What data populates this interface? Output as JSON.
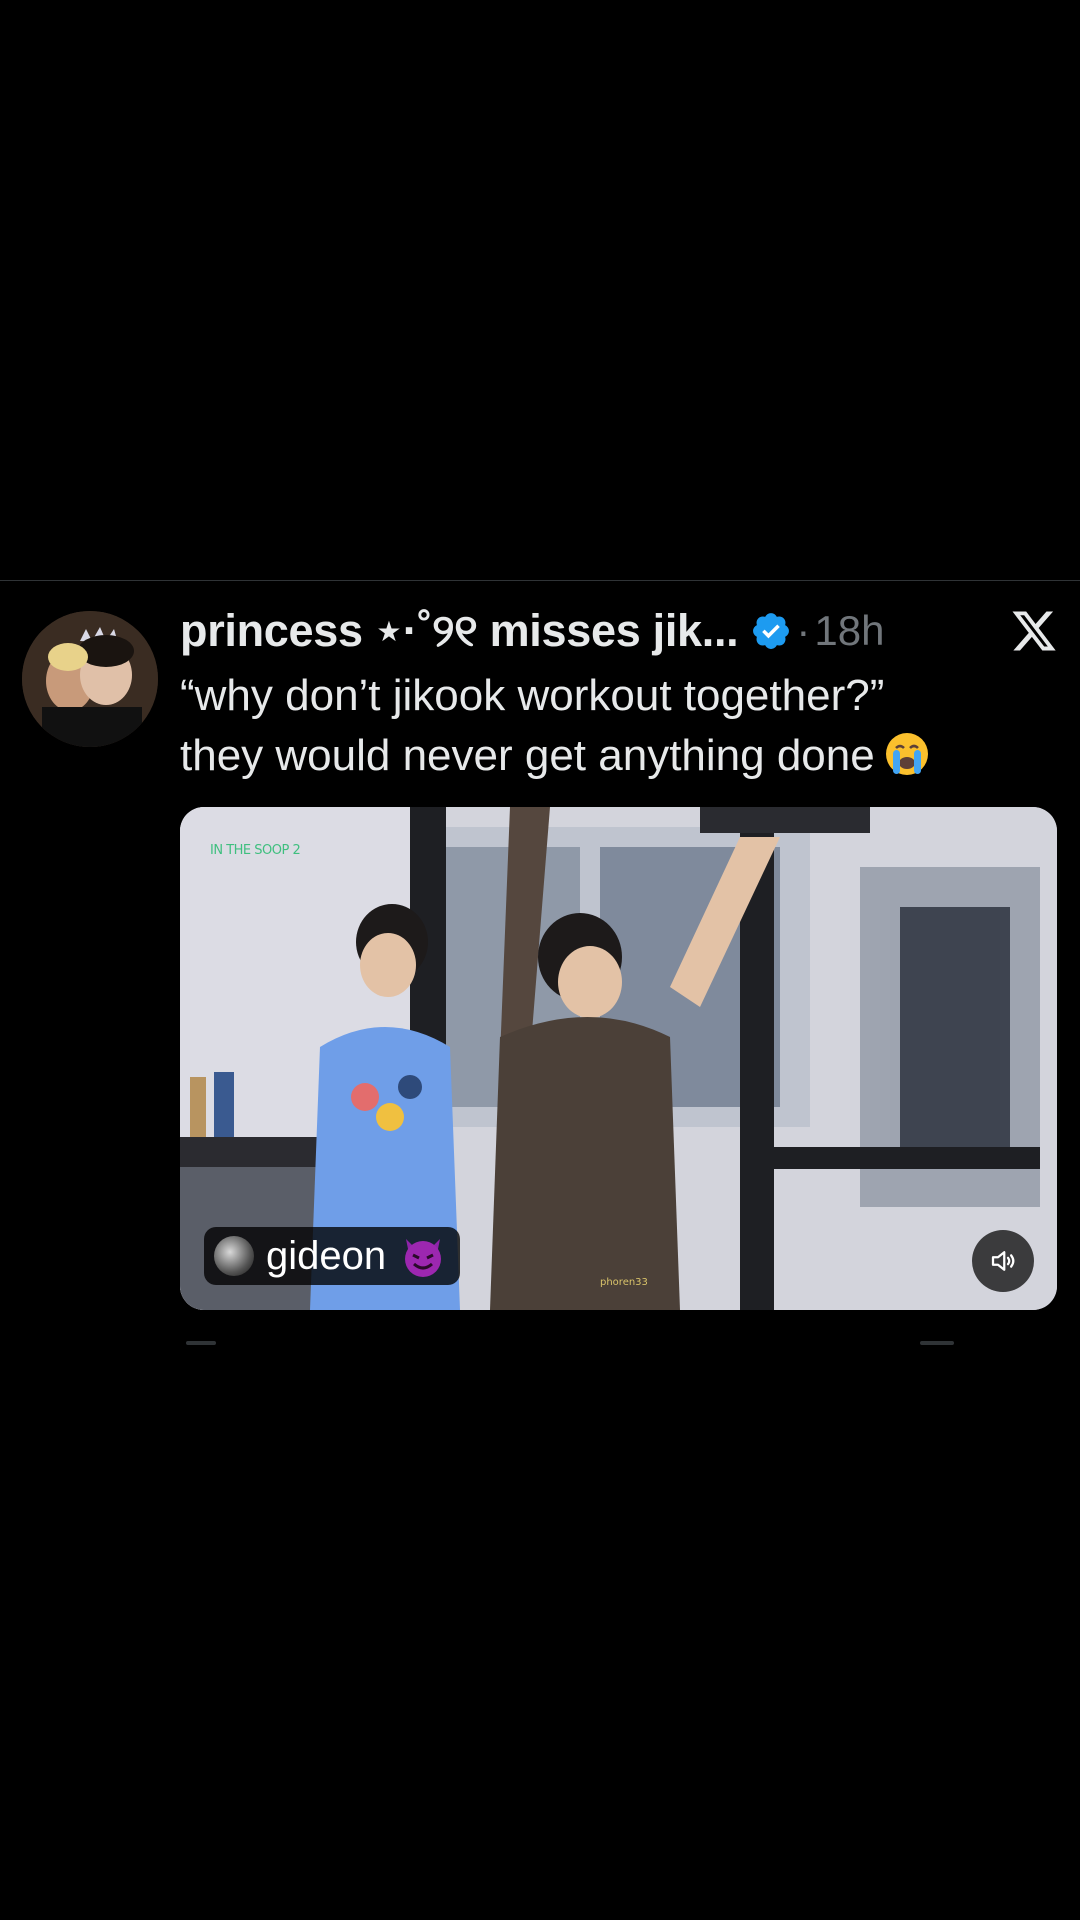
{
  "tweet": {
    "display_name": "princess ⋆·˚୨୧ misses jik...",
    "separator": "·",
    "time": "18h",
    "text_line_1": "“why don’t jikook workout together?”",
    "text_line_2": "they would never get anything done",
    "emoji": "loudly-crying-face"
  },
  "media": {
    "show_logo_text": "IN THE SOOP 2",
    "badge_name": "gideon",
    "badge_emoji": "smiling-face-with-horns",
    "watermark": "phoren33",
    "sound_icon": "speaker-muted-icon"
  },
  "colors": {
    "background": "#000000",
    "text": "#e7e9ea",
    "secondary": "#71767b",
    "verified": "#1d9bf0",
    "divider": "#2f3336"
  }
}
